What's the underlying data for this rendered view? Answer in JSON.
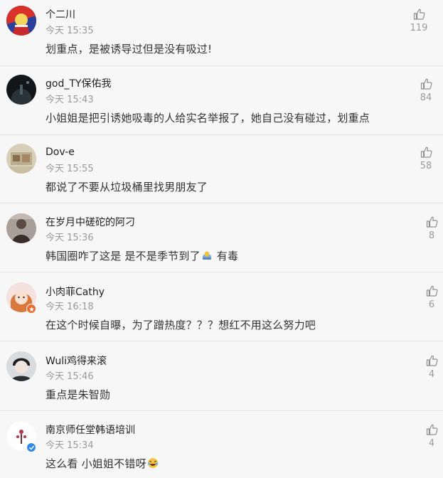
{
  "colors": {
    "background": "#f7f7f7",
    "divider": "#e3e3e3",
    "username": "#222222",
    "meta": "#9a9a9a",
    "comment_text": "#333333",
    "badge_orange": "#ef6a2e",
    "badge_blue": "#2e8ce6"
  },
  "comments": [
    {
      "username": "个二川",
      "time": "今天 15:35",
      "text": "划重点，是被诱导过但是没有吸过!",
      "likes": "119",
      "like_icon": "thumbs-up-icon"
    },
    {
      "username": "god_TY保佑我",
      "time": "今天 15:43",
      "text": "小姐姐是把引诱她吸毒的人给实名举报了，她自己没有碰过，划重点",
      "likes": "84",
      "like_icon": "thumbs-up-icon"
    },
    {
      "username": "Dov-e",
      "time": "今天 15:55",
      "text": "都说了不要从垃圾桶里找男朋友了",
      "likes": "58",
      "like_icon": "thumbs-up-icon"
    },
    {
      "username": "在岁月中磋砣的阿刁",
      "time": "今天 15:36",
      "text_before": "韩国圈咋了这是 是不是季节到了",
      "emoji": "crab-emoji-icon",
      "text_after": " 有毒",
      "likes": "8",
      "like_icon": "thumbs-up-icon"
    },
    {
      "username": "小肉菲Cathy",
      "time": "今天 16:18",
      "text": "在这个时候自曝，为了蹭热度？？？想红不用这么努力吧",
      "likes": "6",
      "like_icon": "thumbs-up-icon",
      "badge": "orange-verified-badge-icon"
    },
    {
      "username": "Wuli鸡得来滚",
      "time": "今天 15:46",
      "text": "重点是朱智勋",
      "likes": "4",
      "like_icon": "thumbs-up-icon"
    },
    {
      "username": "南京师任堂韩语培训",
      "time": "今天 15:34",
      "text_before": "这么看 小姐姐不错呀",
      "emoji": "laugh-cry-emoji-icon",
      "likes": "4",
      "like_icon": "thumbs-up-icon",
      "badge": "blue-verified-badge-icon"
    }
  ]
}
